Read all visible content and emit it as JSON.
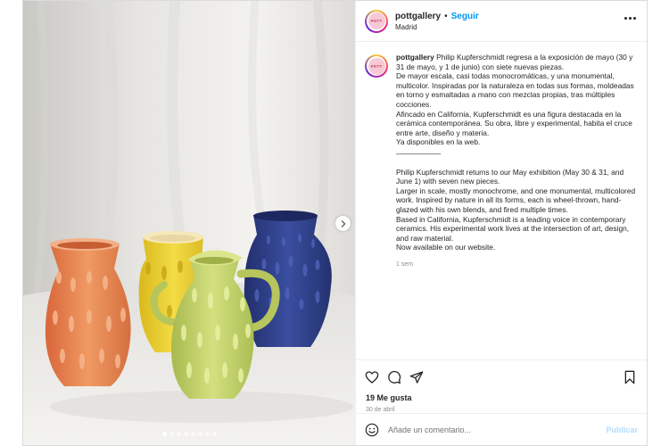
{
  "post": {
    "image_alt": "Four textured ceramic vases: orange, yellow, lime green jug, navy blue",
    "carousel": {
      "total_slides": 8,
      "active_slide": 1
    }
  },
  "header": {
    "username": "pottgallery",
    "separator": "•",
    "follow_label": "Seguir",
    "location": "Madrid",
    "avatar_text": "POTT"
  },
  "caption": {
    "username": "pottgallery",
    "lines_es": [
      "Philip Kupferschmidt regresa a la exposición de mayo (30 y 31 de mayo, y 1 de junio) con siete nuevas piezas.",
      "De mayor escala, casi todas monocromáticas, y una monumental, multicolor. Inspiradas por la naturaleza en todas sus formas, moldeadas en torno y esmaltadas a mano con mezclas propias, tras múltiples cocciones.",
      "Afincado en California, Kupferschmidt es una figura destacada en la cerámica contemporánea. Su obra, libre y experimental, habita el cruce entre arte, diseño y materia.",
      "Ya disponibles en la web."
    ],
    "divider": "——————",
    "lines_en": [
      "Philip Kupferschmidt returns to our May exhibition (May 30 & 31, and June 1) with seven new pieces.",
      "Larger in scale, mostly monochrome, and one monumental, multicolored work. Inspired by nature in all its forms, each is wheel-thrown, hand-glazed with his own blends, and fired multiple times.",
      "Based in California, Kupferschmidt is a leading voice in contemporary ceramics. His experimental work lives at the intersection of art, design, and raw material.",
      "Now available on our website."
    ],
    "time": "1 sem"
  },
  "actions": {
    "like_icon": "heart-icon",
    "comment_icon": "comment-icon",
    "share_icon": "share-icon",
    "save_icon": "bookmark-icon"
  },
  "likes": "19 Me gusta",
  "date": "30 de abril",
  "comment_box": {
    "placeholder": "Añade un comentario...",
    "publish_label": "Publicar"
  },
  "colors": {
    "accent": "#0095f6",
    "publish_disabled": "#b3dbff",
    "vase_orange": "#e9834f",
    "vase_yellow": "#e8cc2f",
    "vase_green": "#c3d46a",
    "vase_blue": "#2e3f8a"
  }
}
